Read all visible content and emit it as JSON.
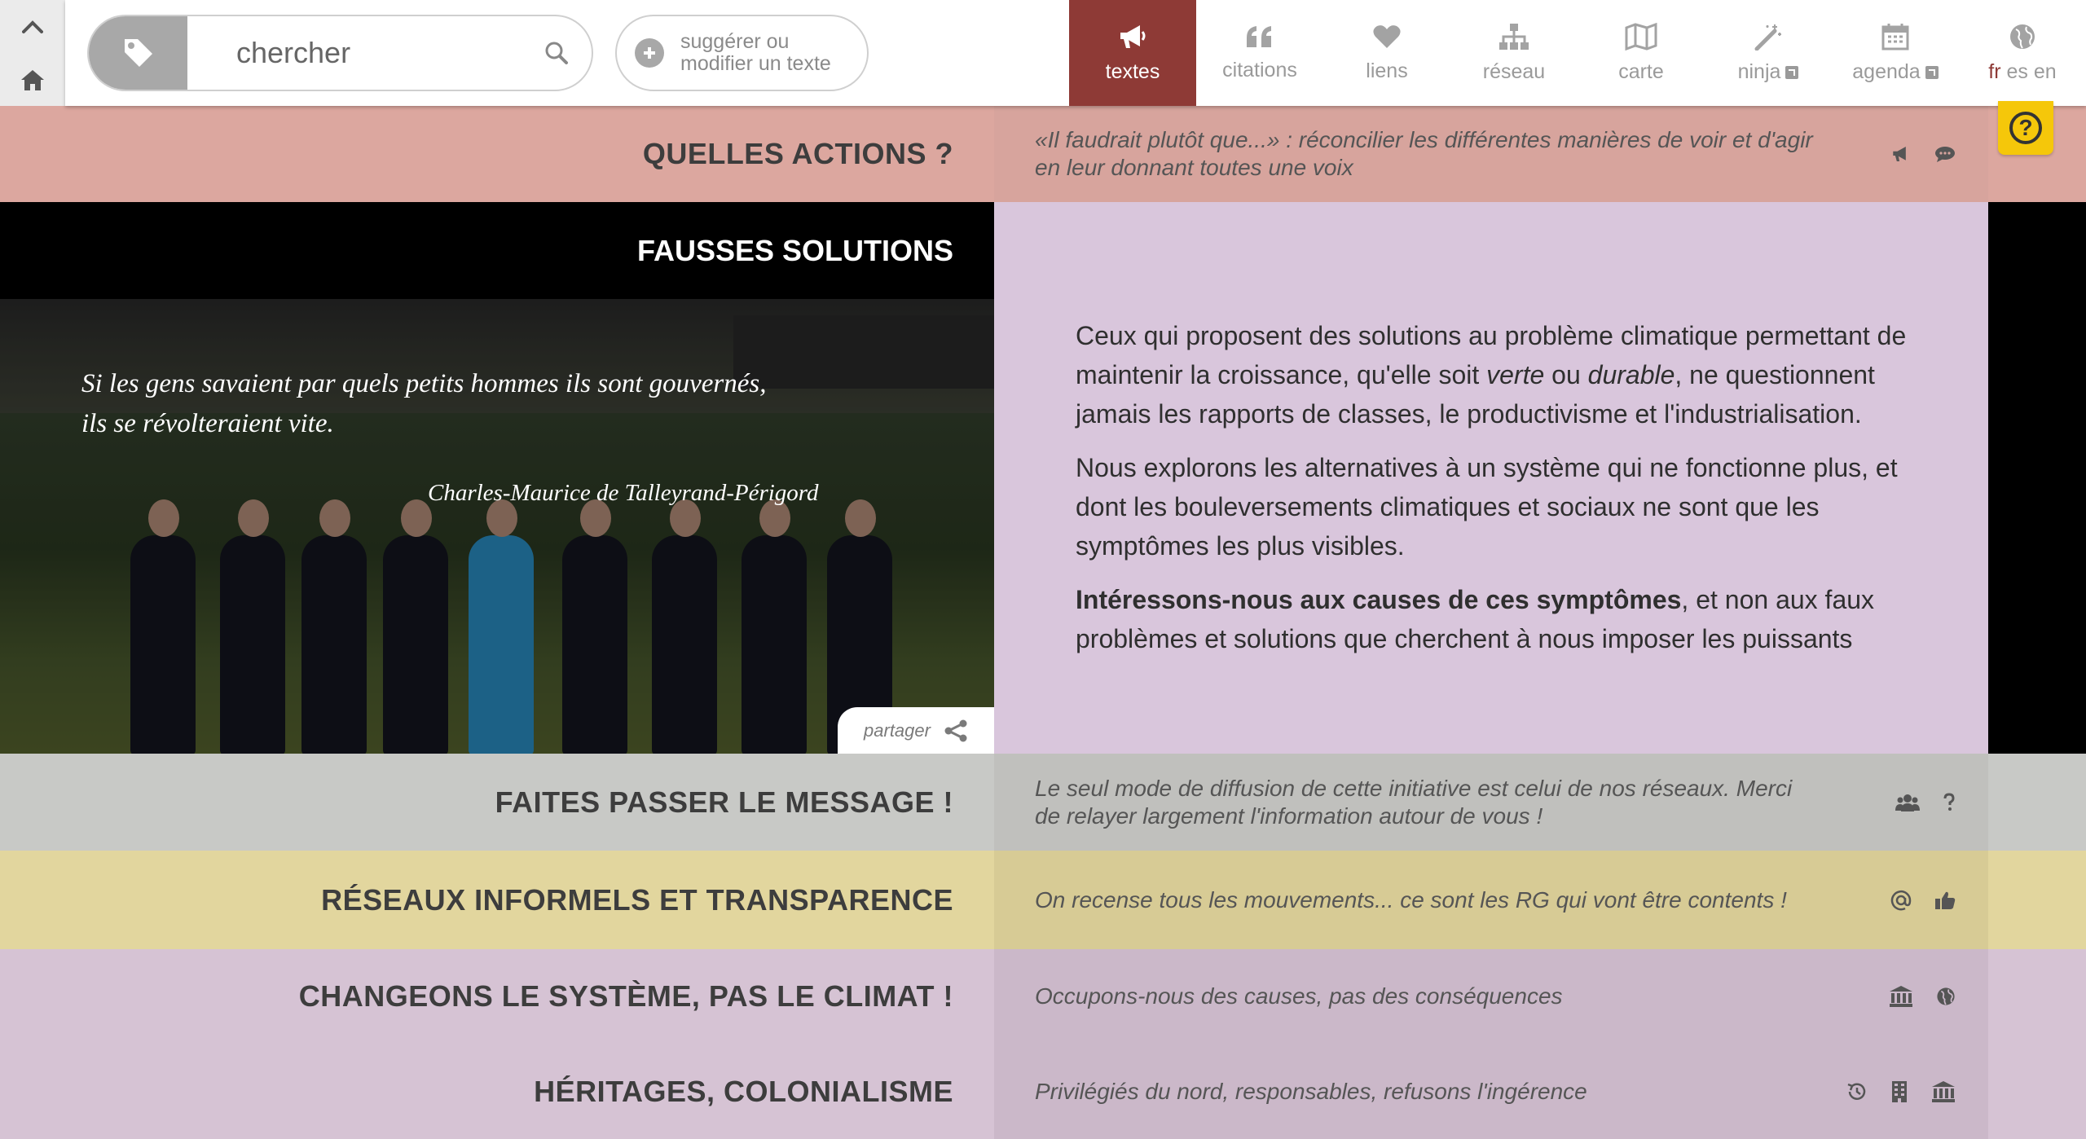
{
  "search": {
    "placeholder": "chercher"
  },
  "suggest": {
    "line1": "suggérer ou",
    "line2": "modifier un texte"
  },
  "nav": {
    "tabs": [
      {
        "label": "textes",
        "icon": "megaphone-icon"
      },
      {
        "label": "citations",
        "icon": "quote-icon"
      },
      {
        "label": "liens",
        "icon": "heart-icon"
      },
      {
        "label": "réseau",
        "icon": "sitemap-icon"
      },
      {
        "label": "carte",
        "icon": "map-icon"
      },
      {
        "label": "ninja",
        "icon": "magic-wand-icon"
      },
      {
        "label": "agenda",
        "icon": "calendar-icon"
      }
    ],
    "lang_current": "fr",
    "lang_others": "es en"
  },
  "rows": {
    "actions": {
      "title": "QUELLES ACTIONS ?",
      "subtitle": "«Il faudrait plutôt que...» : réconcilier les différentes manières de voir et d'agir en leur donnant toutes une voix"
    },
    "message": {
      "title": "FAITES PASSER LE MESSAGE !",
      "subtitle": "Le seul mode de diffusion de cette initiative est celui de nos réseaux. Merci de relayer largement l'information autour de vous !"
    },
    "reseaux": {
      "title": "RÉSEAUX INFORMELS ET TRANSPARENCE",
      "subtitle": "On recense tous les mouvements... ce sont les RG qui vont être contents !"
    },
    "systeme": {
      "title": "CHANGEONS LE SYSTÈME, PAS LE CLIMAT !",
      "subtitle": "Occupons-nous des causes, pas des conséquences"
    },
    "heritages": {
      "title": "HÉRITAGES, COLONIALISME",
      "subtitle": "Privilégiés du nord, responsables, refusons l'ingérence"
    }
  },
  "hero": {
    "title": "FAUSSES SOLUTIONS",
    "quote_line1": "Si les gens savaient par quels petits hommes ils sont gouvernés,",
    "quote_line2": "ils se révolteraient vite.",
    "author": "Charles-Maurice de Talleyrand-Périgord",
    "share_label": "partager",
    "p1_a": "Ceux qui proposent des solutions au problème climatique permettant de maintenir la croissance, qu'elle soit ",
    "p1_verte": "verte",
    "p1_ou": " ou ",
    "p1_durable": "durable",
    "p1_b": ", ne questionnent jamais les rapports de classes, le productivisme et l'industrialisation.",
    "p2": "Nous explorons les alternatives à un système qui ne fonctionne plus, et dont les bouleversements climatiques et sociaux ne sont que les symptômes les plus visibles.",
    "p3_bold": "Intéressons-nous aux causes de ces symptômes",
    "p3_rest": ", et non aux faux problèmes et solutions que cherchent à nous imposer les puissants"
  },
  "help": {
    "label": "?"
  },
  "colors": {
    "active_tab": "#8e3a36",
    "help_yellow": "#f5c70a"
  }
}
